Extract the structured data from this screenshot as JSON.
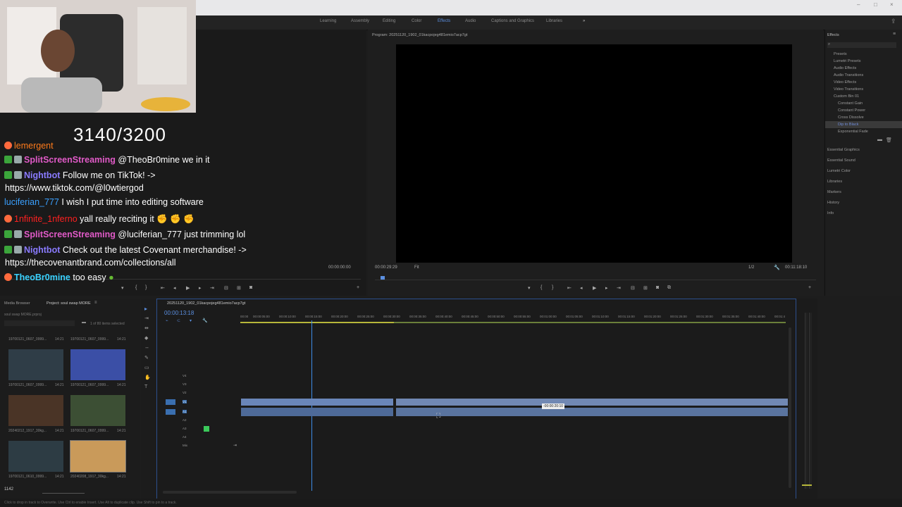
{
  "workspace_bar": {
    "tabs": [
      "Learning",
      "Assembly",
      "Editing",
      "Color",
      "Effects",
      "Audio",
      "Captions and Graphics",
      "Libraries"
    ],
    "active": "Effects",
    "more": "»"
  },
  "stream_overlay": {
    "counter": "3140/3200",
    "chat": [
      {
        "user": "lemergent",
        "text": "",
        "user_class": "u4"
      },
      {
        "user": "SplitScreenStreaming",
        "text": "@TheoBr0mine we in it",
        "user_class": "u1"
      },
      {
        "user": "Nightbot",
        "text": "Follow me on TikTok! ->",
        "user_class": "u2"
      },
      {
        "user": "",
        "text": "https://www.tiktok.com/@l0wtiergod",
        "user_class": ""
      },
      {
        "user": "luciferian_777",
        "text": "I wish I put time into editing software",
        "user_class": "u3"
      },
      {
        "user": "1nfinite_1nferno",
        "text": "yall really reciting it",
        "user_class": "u4"
      },
      {
        "user": "SplitScreenStreaming",
        "text": "@luciferian_777 just trimming lol",
        "user_class": "u1"
      },
      {
        "user": "Nightbot",
        "text": "Check out the latest Covenant merchandise! ->",
        "user_class": "u2"
      },
      {
        "user": "",
        "text": "https://thecovenantbrand.com/collections/all",
        "user_class": ""
      },
      {
        "user": "TheoBr0mine",
        "text": "too easy",
        "user_class": "u5"
      }
    ],
    "viewer_count": "1142"
  },
  "source_monitor": {
    "timecode": "00:00:00:00"
  },
  "program_monitor": {
    "title": "Program: 20251120_1902_01kacpojeg481emio7acp7gt",
    "timecode_left": "00:00:29:29",
    "fit": "Fit",
    "ratio": "1/2",
    "timecode_right": "00:11:18:10"
  },
  "effects_panel": {
    "title": "Effects",
    "tree": [
      "Presets",
      "Lumetri Presets",
      "Audio Effects",
      "Audio Transitions",
      "Video Effects",
      "Video Transitions",
      "Custom Bin 01",
      "Constant Gain",
      "Constant Power",
      "Cross Dissolve",
      "Dip to Black",
      "Exponential Fade"
    ],
    "sections": [
      "Essential Graphics",
      "Essential Sound",
      "Lumetri Color",
      "Libraries",
      "Markers",
      "History",
      "Info"
    ]
  },
  "project_panel": {
    "tabs": [
      "Media Browser",
      "Project: soul swap MORE"
    ],
    "path": "soul swap MORE.prproj",
    "items_selected": "1 of 80 items selected",
    "thumbs": [
      {
        "label": "19700121_0607_0999...",
        "time": "14:21"
      },
      {
        "label": "19700121_0607_0999...",
        "time": "14:21"
      },
      {
        "label": "19700121_0607_0999...",
        "time": "14:21"
      },
      {
        "label": "19700121_0607_0999...",
        "time": "14:21"
      },
      {
        "label": "20240212_1917_30kg...",
        "time": "14:21"
      },
      {
        "label": "19700121_0607_0999...",
        "time": "14:21"
      },
      {
        "label": "19700121_0610_0999...",
        "time": "14:21"
      },
      {
        "label": "20240208_1917_30kg...",
        "time": "14:21"
      }
    ]
  },
  "timeline": {
    "sequence_tab": "20251120_1902_01kacpojeg481emio7acp7gt",
    "timecode": "00:00:13:18",
    "ruler": [
      "00:00",
      "00:00:05:00",
      "00:00:10:00",
      "00:00:15:00",
      "00:00:20:00",
      "00:00:25:00",
      "00:00:30:00",
      "00:00:35:00",
      "00:00:40:00",
      "00:00:45:00",
      "00:00:50:00",
      "00:00:55:00",
      "00:01:00:00",
      "00:01:05:00",
      "00:01:10:00",
      "00:01:15:00",
      "00:01:20:00",
      "00:01:25:00",
      "00:01:30:00",
      "00:01:35:00",
      "00:01:40:00",
      "00:01:4"
    ],
    "video_tracks": [
      "V4",
      "V3",
      "V2",
      "V1"
    ],
    "audio_tracks": [
      "A1",
      "A2",
      "A3",
      "A4"
    ],
    "mix": "Mix",
    "tooltip": "-00:00:20:10"
  },
  "status_bar": {
    "text": "Click to drop in track to Overwrite. Use Ctrl to enable Insert. Use Alt to duplicate clip. Use Shift to pin to a track."
  },
  "colors": {
    "accent": "#5b8fe0",
    "clip": "#5d79a8",
    "chat_check": "#3ba53b"
  }
}
